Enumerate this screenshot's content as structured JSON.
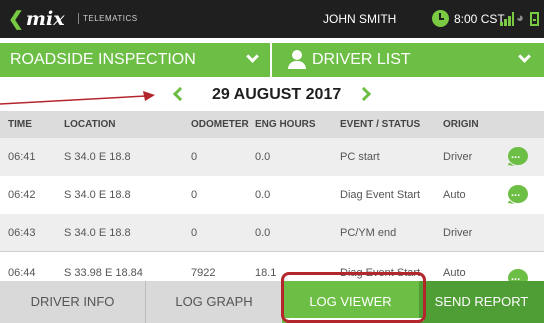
{
  "app": {
    "logo_text": "mix",
    "logo_sub": "TELEMATICS",
    "user_name": "JOHN SMITH",
    "time": "8:00 CST"
  },
  "header": {
    "left_title": "ROADSIDE INSPECTION",
    "right_title": "DRIVER LIST"
  },
  "date_nav": {
    "date": "29 AUGUST 2017"
  },
  "table": {
    "columns": [
      "TIME",
      "LOCATION",
      "ODOMETER",
      "ENG HOURS",
      "EVENT / STATUS",
      "ORIGIN"
    ],
    "rows": [
      {
        "time": "06:41",
        "location": "S 34.0 E 18.8",
        "odometer": "0",
        "eng_hours": "0.0",
        "event": "PC start",
        "origin": "Driver",
        "has_note": true
      },
      {
        "time": "06:42",
        "location": "S 34.0 E 18.8",
        "odometer": "0",
        "eng_hours": "0.0",
        "event": "Diag Event Start",
        "origin": "Auto",
        "has_note": true
      },
      {
        "time": "06:43",
        "location": "S 34.0 E 18.8",
        "odometer": "0",
        "eng_hours": "0.0",
        "event": "PC/YM end",
        "origin": "Driver",
        "has_note": false
      },
      {
        "time": "06:44",
        "location": "S 33.98 E 18.84",
        "odometer": "7922",
        "eng_hours": "18.1",
        "event": "Diag Event Start",
        "origin": "Auto",
        "has_note": true
      }
    ]
  },
  "tabs": {
    "driver_info": "DRIVER INFO",
    "log_graph": "LOG GRAPH",
    "log_viewer": "LOG VIEWER",
    "send_report": "SEND REPORT"
  },
  "icons": {
    "back": "back-chevron-icon",
    "clock": "clock-icon",
    "signal": "signal-icon",
    "wifi": "wifi-icon",
    "battery": "battery-icon",
    "menu": "kebab-menu-icon",
    "person": "person-icon",
    "chat": "chat-icon",
    "note_glyph": "..."
  },
  "colors": {
    "brand_green": "#6cbe45",
    "dark_green": "#4f9e35",
    "topbar": "#1f1f1f",
    "annotation_red": "#b3262c"
  }
}
